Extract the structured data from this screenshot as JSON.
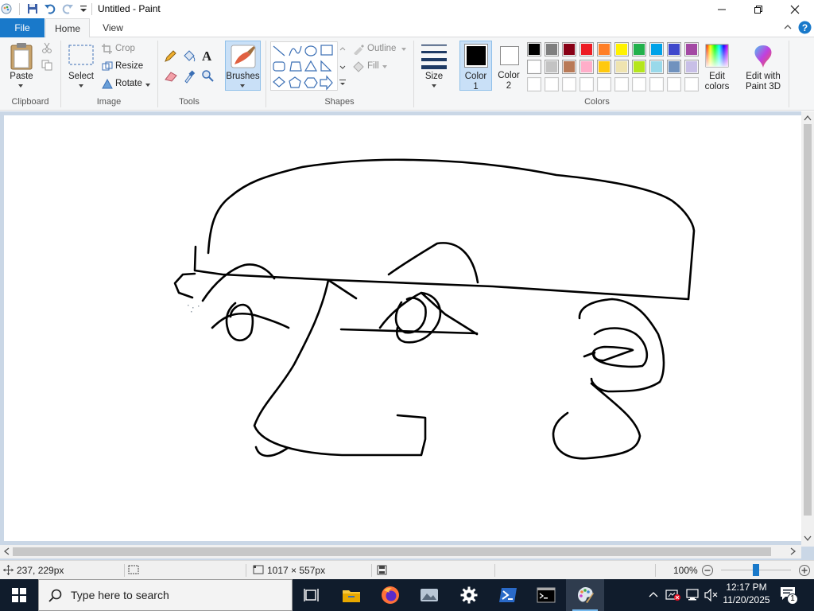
{
  "window": {
    "title": "Untitled - Paint"
  },
  "tabs": {
    "file": "File",
    "home": "Home",
    "view": "View"
  },
  "clipboard": {
    "paste": "Paste",
    "group": "Clipboard"
  },
  "image": {
    "select": "Select",
    "crop": "Crop",
    "resize": "Resize",
    "rotate": "Rotate",
    "group": "Image"
  },
  "tools": {
    "group": "Tools"
  },
  "brushes": {
    "label": "Brushes"
  },
  "shapes": {
    "outline": "Outline",
    "fill": "Fill",
    "group": "Shapes"
  },
  "size": {
    "label": "Size"
  },
  "colors": {
    "color1_label": "Color",
    "color1_num": "1",
    "color2_label": "Color",
    "color2_num": "2",
    "color1_value": "#000000",
    "color2_value": "#ffffff",
    "edit_colors": "Edit colors",
    "edit_colors_l1": "Edit",
    "edit_colors_l2": "colors",
    "paint3d_l1": "Edit with",
    "paint3d_l2": "Paint 3D",
    "group": "Colors",
    "palette_row1": [
      "#000000",
      "#7f7f7f",
      "#880015",
      "#ed1c24",
      "#ff7f27",
      "#fff200",
      "#22b14c",
      "#00a2e8",
      "#3f48cc",
      "#a349a4"
    ],
    "palette_row2": [
      "#ffffff",
      "#c3c3c3",
      "#b97a57",
      "#ffaec9",
      "#ffc90e",
      "#efe4b0",
      "#b5e61d",
      "#99d9ea",
      "#7092be",
      "#c8bfe7"
    ],
    "palette_row3": [
      "#ffffff",
      "#ffffff",
      "#ffffff",
      "#ffffff",
      "#ffffff",
      "#ffffff",
      "#ffffff",
      "#ffffff",
      "#ffffff",
      "#ffffff"
    ]
  },
  "status": {
    "cursor_pos": "237, 229px",
    "canvas_size": "1017 × 557px",
    "zoom": "100%",
    "zoom_level": 0.5
  },
  "taskbar": {
    "search_placeholder": "Type here to search",
    "time": "12:17 PM",
    "date": "11/20/2025",
    "notif_count": "1"
  }
}
